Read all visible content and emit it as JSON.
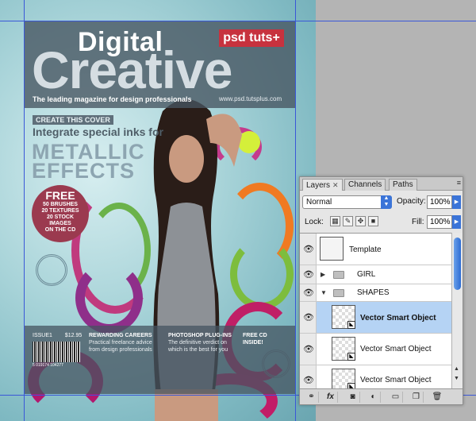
{
  "cover": {
    "title_small": "Digital",
    "title_big": "Creative",
    "brand_badge": "psd tuts+",
    "tagline": "The leading magazine for design professionals",
    "site_url": "www.psd.tutsplus.com",
    "cover_label": "CREATE THIS COVER",
    "cover_subhead": "Integrate special inks for",
    "cover_head_line1": "METALLIC",
    "cover_head_line2": "EFFECTS",
    "free_offer": {
      "line1": "FREE",
      "line2": "50 BRUSHES",
      "line3": "20 TEXTURES",
      "line4": "20 STOCK",
      "line5": "IMAGES",
      "line6": "ON THE CD"
    },
    "issue": "ISSUE1",
    "price": "$12.95",
    "barcode_number": "5 019174 104277",
    "bottom_features": [
      {
        "heading": "REWARDING CAREERS",
        "text": "Practical freelance advice from design professionals"
      },
      {
        "heading": "PHOTOSHOP PLUG-INS",
        "text": "The definitive verdict on which is the best for you"
      },
      {
        "heading": "FREE CD",
        "text": "INSIDE!"
      }
    ]
  },
  "panel": {
    "tabs": [
      {
        "label": "Layers",
        "close": "✕",
        "active": true
      },
      {
        "label": "Channels",
        "active": false
      },
      {
        "label": "Paths",
        "active": false
      }
    ],
    "menu_icon": "≡",
    "blend_mode": "Normal",
    "opacity_label": "Opacity:",
    "opacity_value": "100%",
    "lock_label": "Lock:",
    "fill_label": "Fill:",
    "fill_value": "100%",
    "layers": [
      {
        "name": "Template",
        "type": "layer",
        "visible": true,
        "selected": false
      },
      {
        "name": "GIRL",
        "type": "group",
        "expanded": false,
        "visible": true,
        "selected": false
      },
      {
        "name": "SHAPES",
        "type": "group",
        "expanded": true,
        "visible": true,
        "selected": false
      },
      {
        "name": "Vector Smart Object",
        "type": "smart-object",
        "visible": true,
        "selected": true
      },
      {
        "name": "Vector Smart Object",
        "type": "smart-object",
        "visible": true,
        "selected": false
      },
      {
        "name": "Vector Smart Object",
        "type": "smart-object",
        "visible": true,
        "selected": false
      }
    ],
    "bottom_icons": [
      "link-layers-icon",
      "fx-icon",
      "mask-icon",
      "adjustment-icon",
      "new-group-icon",
      "new-layer-icon",
      "trash-icon"
    ]
  },
  "colors": {
    "accent": "#3b74d8",
    "selection": "#b5d3f4",
    "guide": "#3a57d8",
    "badge": "#c7323e"
  }
}
